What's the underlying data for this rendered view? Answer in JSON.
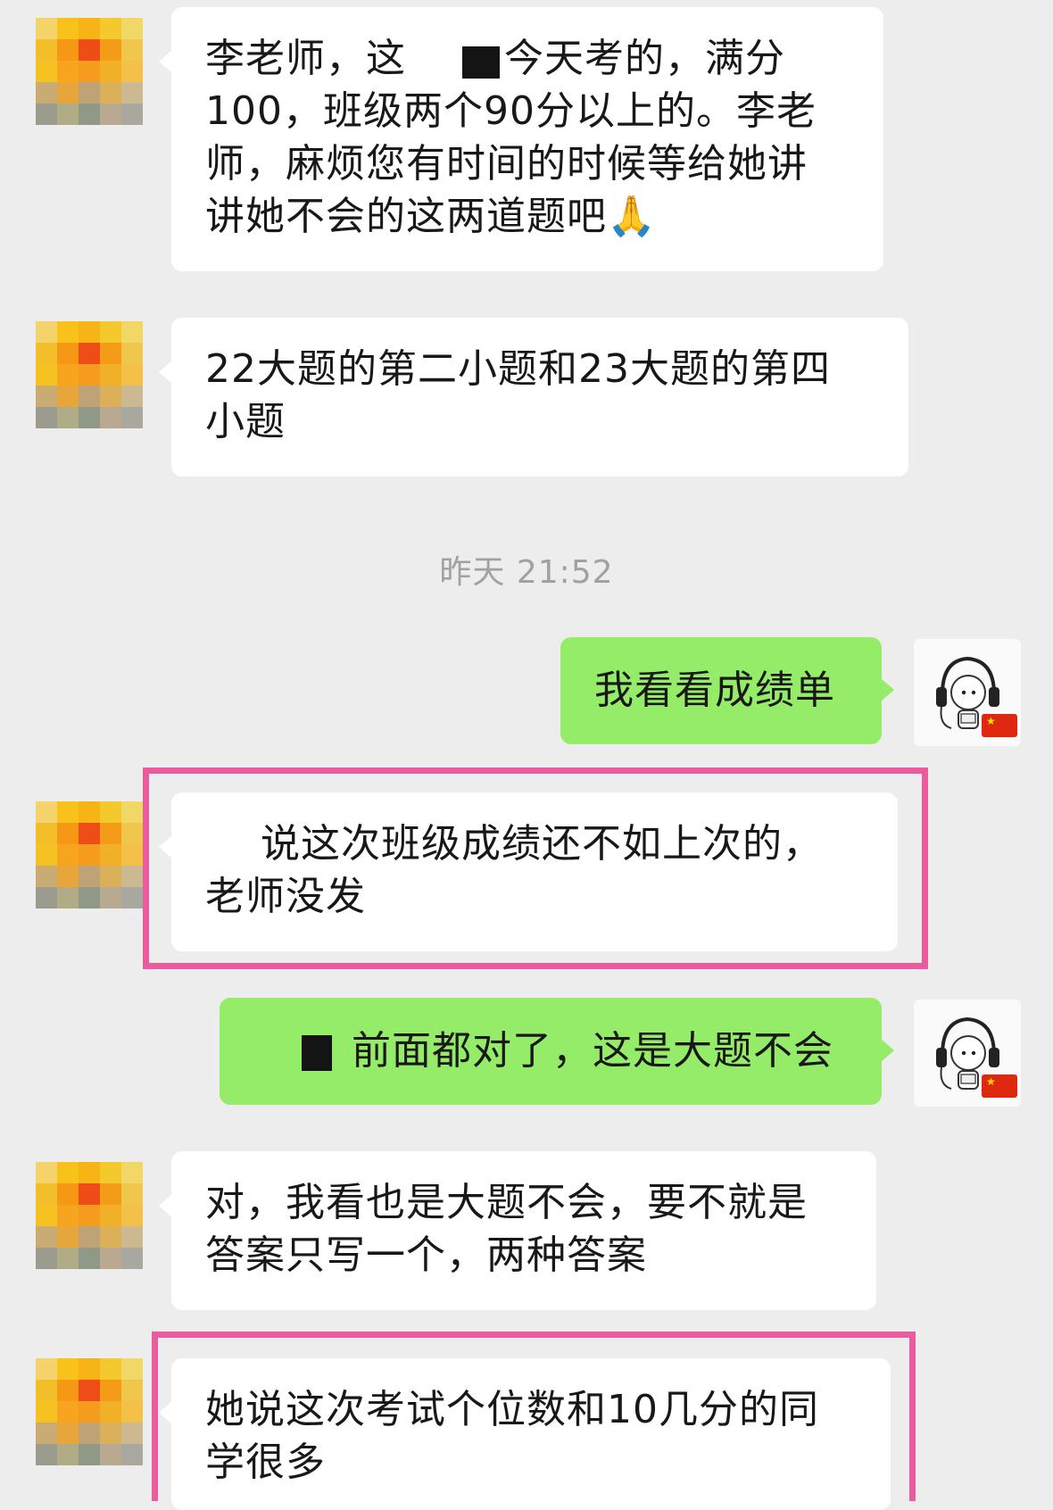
{
  "chat": {
    "timestamp": "昨天 21:52",
    "messages": [
      {
        "sender": "other",
        "lines": [
          "李老师，这",
          "今天考的，满分",
          "100，班级两个90分以上的。李老",
          "师，麻烦您有时间的时候等给她讲",
          "讲她不会的这两道题吧🙏"
        ]
      },
      {
        "sender": "other",
        "lines": [
          "22大题的第二小题和23大题的第四",
          "小题"
        ]
      },
      {
        "sender": "me",
        "lines": [
          "我看看成绩单"
        ]
      },
      {
        "sender": "other",
        "lines": [
          "说这次班级成绩还不如上次的，",
          "老师没发"
        ]
      },
      {
        "sender": "me",
        "lines": [
          "前面都对了，这是大题不会"
        ]
      },
      {
        "sender": "other",
        "lines": [
          "对，我看也是大题不会，要不就是",
          "答案只写一个，两种答案"
        ]
      },
      {
        "sender": "other",
        "lines": [
          "她说这次考试个位数和10几分的同",
          "学很多"
        ]
      }
    ]
  },
  "colors": {
    "background": "#ededed",
    "incoming_bubble": "#ffffff",
    "outgoing_bubble": "#95ec69",
    "highlight_box": "#eb5c9e",
    "timestamp_text": "#a1a1a1"
  },
  "icons": {
    "contact_avatar": "pixelated-avatar",
    "my_avatar": "headphones-character-avatar",
    "flag": "china-flag-icon",
    "emoji": "folded-hands-emoji"
  }
}
